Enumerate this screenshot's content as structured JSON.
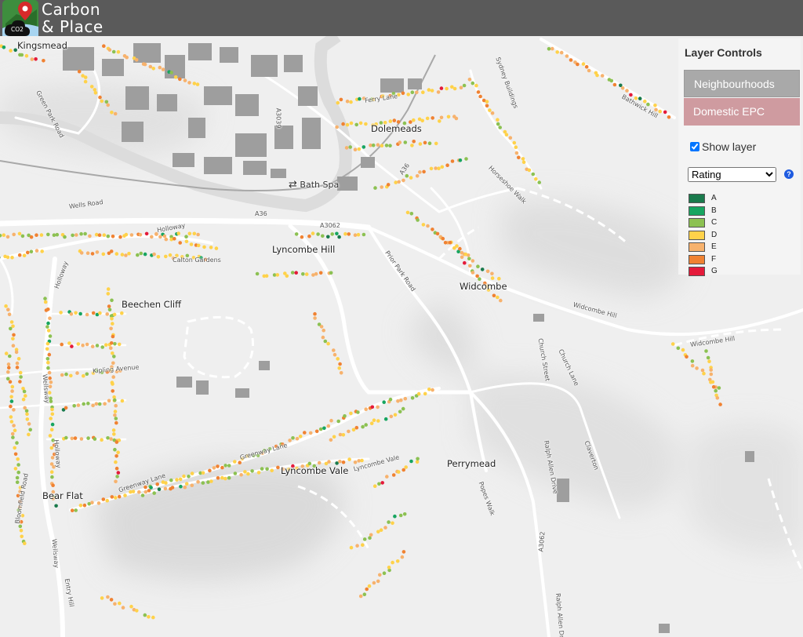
{
  "app": {
    "name_line1": "Carbon",
    "name_line2": "& Place",
    "logo_text": "CO2",
    "logo_icon": "map-pin-icon"
  },
  "layer_controls": {
    "title": "Layer Controls",
    "tabs": [
      {
        "label": "Neighbourhoods",
        "color": "#a9a9a9"
      },
      {
        "label": "Domestic EPC",
        "color": "#cf9ba0"
      }
    ],
    "show_layer": {
      "label": "Show layer",
      "checked": true
    },
    "attribute_select": {
      "selected": "Rating"
    },
    "help_icon": "question-circle-icon",
    "legend": [
      {
        "label": "A",
        "color": "#1a7a4c"
      },
      {
        "label": "B",
        "color": "#17a560"
      },
      {
        "label": "C",
        "color": "#8cc152"
      },
      {
        "label": "D",
        "color": "#ffd24a"
      },
      {
        "label": "E",
        "color": "#f7b26d"
      },
      {
        "label": "F",
        "color": "#f08232"
      },
      {
        "label": "G",
        "color": "#e41a3a"
      }
    ]
  },
  "map_labels": {
    "places": {
      "kingsmead": "Kingsmead",
      "dolemeads": "Dolemeads",
      "lyncombe_hill": "Lyncombe Hill",
      "widcombe": "Widcombe",
      "beechen_cliff": "Beechen Cliff",
      "lyncombe_vale": "Lyncombe Vale",
      "perrymead": "Perrymead",
      "bear_flat": "Bear Flat"
    },
    "stations": {
      "bath_spa": "Bath Spa"
    },
    "roads": {
      "green_park_road": "Green Park Road",
      "ferry_lane": "Ferry Lane",
      "a3039": "A3039",
      "a36_north": "A36",
      "a36_south": "A36",
      "wells_road": "Wells Road",
      "holloway_top": "Holloway",
      "holloway_side": "Holloway",
      "calton_gardens": "Calton Gardens",
      "a3062": "A3062",
      "prior_park_road": "Prior Park Road",
      "widcombe_hill": "Widcombe Hill",
      "widcombe_hill_2": "Widcombe Hill",
      "horseshoe_walk": "Horseshoe Walk",
      "sydney_buildings": "Sydney Buildings",
      "bathwick_hill": "Bathwick Hill",
      "church_street": "Church Street",
      "church_lane": "Church Lane",
      "kipling_avenue": "Kipling Avenue",
      "wellsway": "Wellsway",
      "greenway_lane": "Greenway Lane",
      "lyncombe_vale_road": "Lyncombe Vale",
      "ralph_allen_drive": "Ralph Allen Drive",
      "a3062_south": "A3062",
      "pope_walk": "Popes Walk",
      "ralph_allen_drive_2": "Ralph Allen Drive",
      "greenway_lane_2": "Greenway Lane",
      "bloomfield_road": "Bloomfield Road",
      "holloway_lower": "Holloway",
      "wellsway_2": "Wellsway",
      "east_way": "Entry Hill",
      "jenny_lind": "Claverton"
    }
  }
}
